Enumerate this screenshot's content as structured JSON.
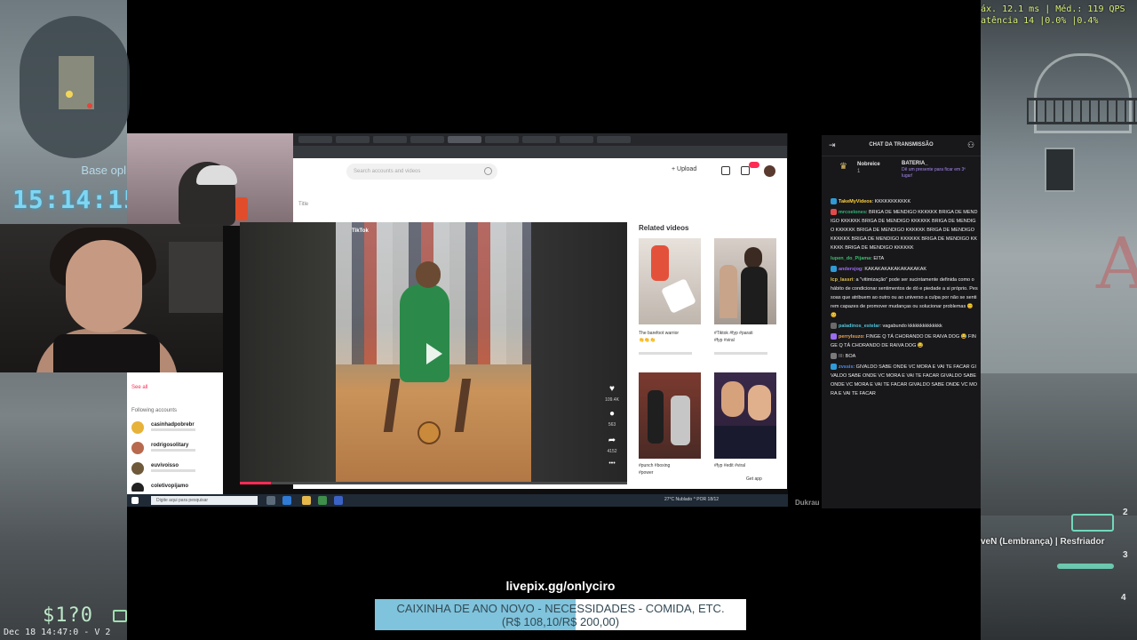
{
  "game_hud": {
    "base_text": "Base opl",
    "clock": "15:14:15",
    "money": "$1?0",
    "date_text": "Dec 18 14:47:0 - V 2",
    "perf_line1": "áx.  12.1 ms | Méd.:  119 QPS",
    "perf_line2": "atência  14   |0.0%  |0.4%",
    "killfeed": "veN (Lembrança) | Resfriador",
    "slots": [
      "2",
      "3",
      "4"
    ]
  },
  "browser": {
    "search_placeholder": "Search accounts and videos",
    "upload_label": "+ Upload",
    "title_hint": "Title",
    "sidebar": {
      "see_all": "See all",
      "following_label": "Following accounts",
      "accounts": [
        {
          "name": "casinhadpobrebr",
          "color": "#e7b23a"
        },
        {
          "name": "rodrigosolitary",
          "color": "#b86a4e"
        },
        {
          "name": "euvivoisso",
          "color": "#6e5a3a"
        },
        {
          "name": "coletivopijamo",
          "color": "#222222"
        }
      ]
    },
    "video": {
      "logo": "TikTok",
      "actions": [
        {
          "icon": "♥",
          "count": "109.4K"
        },
        {
          "icon": "●",
          "count": "563"
        },
        {
          "icon": "➦",
          "count": "4152"
        },
        {
          "icon": "•••",
          "count": ""
        }
      ],
      "progress_fraction": 0.08
    },
    "related": {
      "title": "Related videos",
      "items": [
        {
          "caption": "The barefoot warrior",
          "sub": "👏👏👏"
        },
        {
          "caption": "#Tiktok #fyp #parati",
          "sub": "#fyp #viral"
        },
        {
          "caption": "#punch #boxing",
          "sub": "#power"
        },
        {
          "caption": "#fyp #edit #viral",
          "sub": "Get app"
        }
      ]
    },
    "taskbar": {
      "search_placeholder": "Digite aqui para pesquisar",
      "tray": "27°C Nublado  ^  POR  18/12"
    }
  },
  "watermark": "Dukrau",
  "chat": {
    "title": "CHAT DA TRANSMISSÃO",
    "pinned": {
      "user": "Nobreice",
      "user_count": "1",
      "label": "BATERIA_",
      "detail": "Dê um presente para ficar em 3º lugar!"
    },
    "messages": [
      {
        "user": "TakeMyVideos",
        "color": "#ffd23f",
        "badge": "#2f9bd6",
        "text": "KKKKKKKKKKK"
      },
      {
        "user": "mrcoelones",
        "color": "#2fb673",
        "badge": "#e14b4b",
        "text": "BRIGA DE MENDIGO KKKKKK BRIGA DE MENDIGO KKKKKK BRIGA DE MENDIGO KKKKKK BRIGA DE MENDIGO KKKKKK BRIGA DE MENDIGO KKKKKK BRIGA DE MENDIGO KKKKKK BRIGA DE MENDIGO KKKKKK BRIGA DE MENDIGO KKKKKK BRIGA DE MENDIGO KKKKKK"
      },
      {
        "user": "lupen_do_Pijama",
        "color": "#3dbd6b",
        "badge": "",
        "text": "EITA"
      },
      {
        "user": "andersjog",
        "color": "#9b6cf0",
        "badge": "#2f9bd6",
        "text": "KAKAKAKAKAKAKAKAKAK"
      },
      {
        "user": "lcp_lassri",
        "color": "#e0c04a",
        "badge": "",
        "text": "a \"vitimização\" pode ser sucintamente definida como o hábito de condicionar sentimentos de dó e piedade a si próprio. Pessoas que atribuem ao outro ou ao universo a culpa por não se sentirem capazes de promover mudanças ou solucionar problemas 😊 😊"
      },
      {
        "user": "paladinos_estelar",
        "color": "#4fc3d9",
        "badge": "#6a6a6a",
        "text": "vagabundo kkkkkkkkkkkkkk"
      },
      {
        "user": "perrylsuzo",
        "color": "#f0a24b",
        "badge": "#9b6cf0",
        "text": "FINGE Q TÁ CHORANDO DE RAIVA DOG 😂 FINGE Q TÁ CHORANDO DE RAIVA DOG 😂"
      },
      {
        "user": "lll",
        "color": "#7a7a7a",
        "badge": "#7a7a7a",
        "text": "BOA"
      },
      {
        "user": "zvssis",
        "color": "#4b8cf0",
        "badge": "#2f9bd6",
        "text": "GIVALDO SABE ONDE VC MORA E VAI TE FACAR GIVALDO SABE ONDE VC MORA E VAI TE FACAR GIVALDO SABE ONDE VC MORA E VAI TE FACAR GIVALDO SABE ONDE VC MORA E VAI TE FACAR"
      }
    ]
  },
  "donation": {
    "url": "livepix.gg/onlyciro",
    "goal_line1": "CAIXINHA DE ANO NOVO - NECESSIDADES - COMIDA, ETC.",
    "goal_line2": "(R$ 108,10/R$ 200,00)",
    "raised": 108.1,
    "target": 200.0
  }
}
